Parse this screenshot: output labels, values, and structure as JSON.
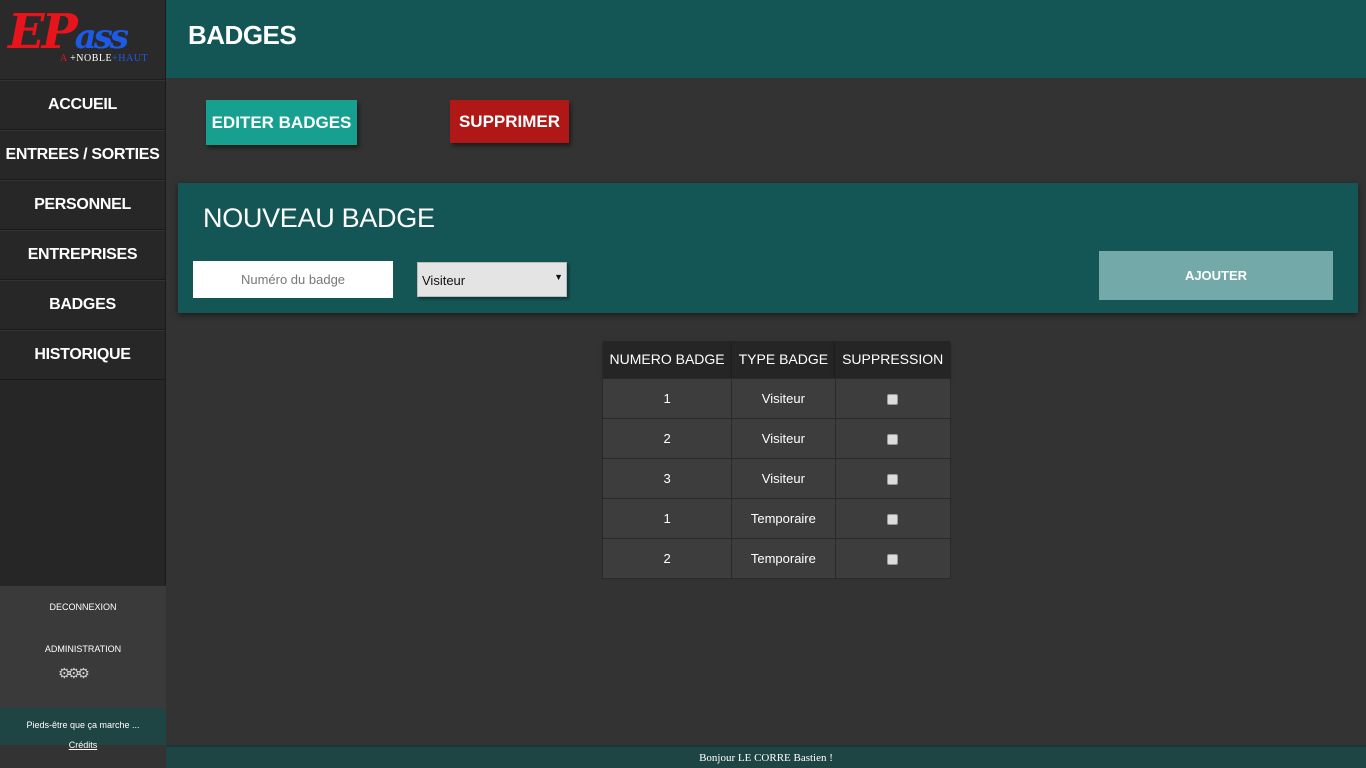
{
  "logo": {
    "main_e": "E",
    "main_p": "P",
    "main_ass": "ass",
    "sub_a": "A ",
    "sub_noble": "+NOBLE",
    "sub_haut": "+HAUT"
  },
  "sidebar": {
    "items": [
      {
        "label": "ACCUEIL"
      },
      {
        "label": "ENTREES / SORTIES"
      },
      {
        "label": "PERSONNEL"
      },
      {
        "label": "ENTREPRISES"
      },
      {
        "label": "BADGES"
      },
      {
        "label": "HISTORIQUE"
      }
    ],
    "deconnexion_label": "DECONNEXION",
    "administration_label": "ADMINISTRATION",
    "gears_icon": "⚙⚙⚙",
    "tagline": "Pieds-être que ça marche ...",
    "credits_label": "Crédits"
  },
  "header": {
    "title": "BADGES"
  },
  "actions": {
    "edit_label": "EDITER BADGES",
    "delete_label": "SUPPRIMER"
  },
  "new_badge": {
    "title": "NOUVEAU BADGE",
    "number_placeholder": "Numéro du badge",
    "type_selected": "Visiteur",
    "add_label": "AJOUTER"
  },
  "table": {
    "headers": [
      "NUMERO BADGE",
      "TYPE BADGE",
      "SUPPRESSION"
    ],
    "rows": [
      {
        "numero": "1",
        "type": "Visiteur"
      },
      {
        "numero": "2",
        "type": "Visiteur"
      },
      {
        "numero": "3",
        "type": "Visiteur"
      },
      {
        "numero": "1",
        "type": "Temporaire"
      },
      {
        "numero": "2",
        "type": "Temporaire"
      }
    ]
  },
  "status": {
    "greeting": "Bonjour LE CORRE Bastien !"
  },
  "colors": {
    "teal_header": "#145656",
    "edit_button": "#17a090",
    "delete_button": "#b01818",
    "add_button": "#74a9a9",
    "background": "#333333"
  }
}
